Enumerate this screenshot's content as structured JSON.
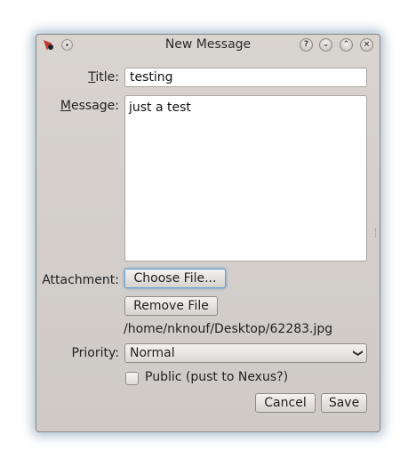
{
  "window": {
    "title": "New Message",
    "buttons": {
      "help": "?",
      "minimize": "⌄",
      "maximize": "⌃",
      "close": "×"
    }
  },
  "form": {
    "title_label_ul": "T",
    "title_label_rest": "itle:",
    "title_value": "testing",
    "message_label_ul": "M",
    "message_label_rest": "essage:",
    "message_value": "just a test",
    "attachment_label": "Attachment:",
    "choose_file_label": "Choose File...",
    "remove_file_label": "Remove File",
    "attachment_path": "/home/nknouf/Desktop/62283.jpg",
    "priority_label": "Priority:",
    "priority_value": "Normal",
    "public_label": "Public (pust to Nexus?)",
    "public_checked": false
  },
  "actions": {
    "cancel_label": "Cancel",
    "save_label": "Save"
  },
  "colors": {
    "window_bg": "#d4cfcb",
    "focus_ring": "#6aa3cf"
  }
}
